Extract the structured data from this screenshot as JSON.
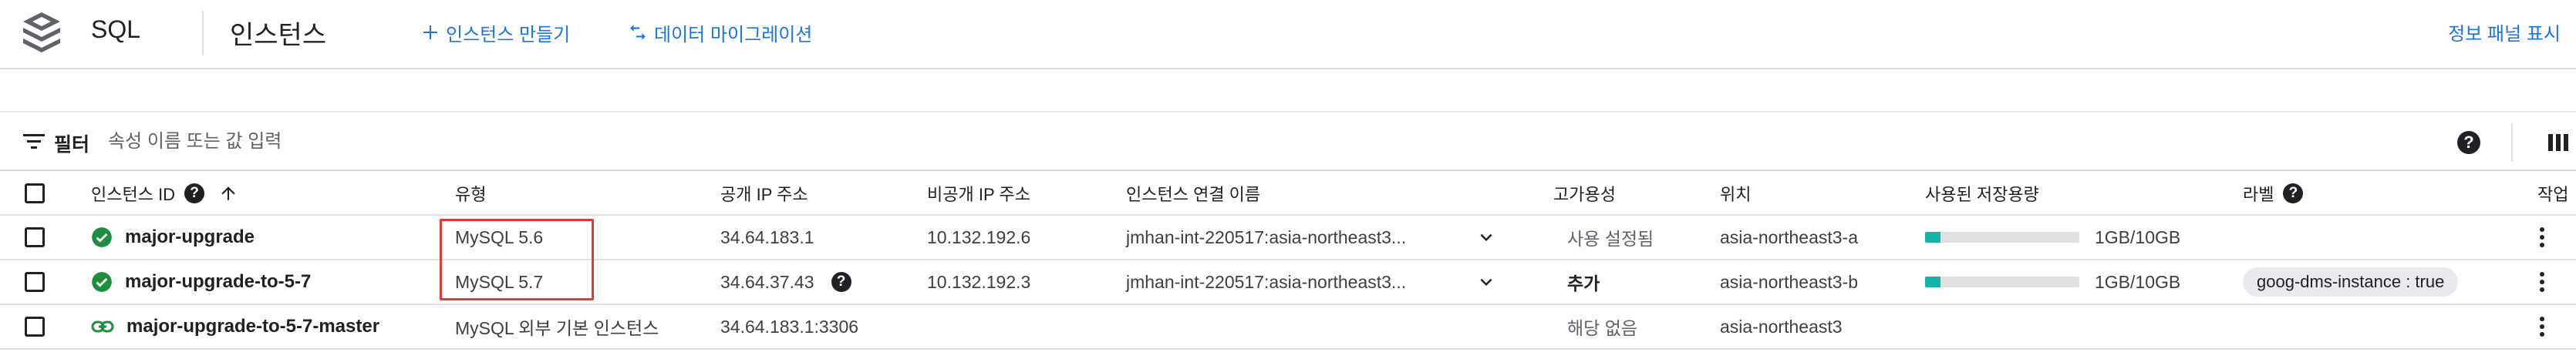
{
  "header": {
    "product_name": "SQL",
    "page_title": "인스턴스",
    "create_instance_label": "인스턴스 만들기",
    "data_migration_label": "데이터 마이그레이션",
    "show_info_panel_label": "정보 패널 표시"
  },
  "filter": {
    "label": "필터",
    "placeholder": "속성 이름 또는 값 입력",
    "help_glyph": "?"
  },
  "table": {
    "columns": {
      "instance_id": "인스턴스 ID",
      "type": "유형",
      "public_ip": "공개 IP 주소",
      "private_ip": "비공개 IP 주소",
      "connection_name": "인스턴스 연결 이름",
      "high_availability": "고가용성",
      "location": "위치",
      "storage_used": "사용된 저장용량",
      "labels": "라벨",
      "actions": "작업"
    },
    "help_glyph": "?",
    "rows": [
      {
        "status": "running",
        "instance_id": "major-upgrade",
        "type": "MySQL 5.6",
        "public_ip": "34.64.183.1",
        "private_ip": "10.132.192.6",
        "connection_name": "jmhan-int-220517:asia-northeast3...",
        "high_availability": "사용 설정됨",
        "location": "asia-northeast3-a",
        "storage_fraction": 0.1,
        "storage_text": "1GB/10GB",
        "label": ""
      },
      {
        "status": "running",
        "instance_id": "major-upgrade-to-5-7",
        "type": "MySQL 5.7",
        "public_ip": "34.64.37.43",
        "private_ip": "10.132.192.3",
        "connection_name": "jmhan-int-220517:asia-northeast3...",
        "high_availability": "추가",
        "location": "asia-northeast3-b",
        "storage_fraction": 0.1,
        "storage_text": "1GB/10GB",
        "label": "goog-dms-instance : true"
      },
      {
        "status": "external",
        "instance_id": "major-upgrade-to-5-7-master",
        "type": "MySQL 외부 기본 인스턴스",
        "public_ip": "34.64.183.1:3306",
        "private_ip": "",
        "connection_name": "",
        "high_availability": "해당 없음",
        "location": "asia-northeast3",
        "storage_fraction": null,
        "storage_text": "",
        "label": ""
      }
    ]
  },
  "colors": {
    "accent": "#1a73e8",
    "status_green": "#1e8e3e",
    "storage_fill": "#12b5a8",
    "highlight_red": "#e53935"
  },
  "icons": {
    "product": "sql-stack-icon",
    "create": "plus-icon",
    "migrate": "migrate-arrows-icon",
    "filter": "filter-lines-icon",
    "columns": "column-display-icon",
    "sort": "arrow-up-icon",
    "running": "check-circle-icon",
    "external": "link-icon",
    "expand": "chevron-down-icon",
    "menu": "more-vert-icon"
  }
}
